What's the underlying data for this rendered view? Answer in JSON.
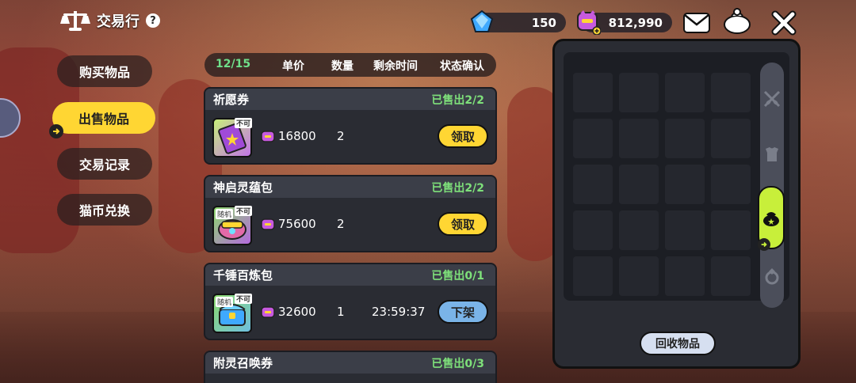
{
  "title": {
    "text": "交易行",
    "help_icon": "question-circle-icon"
  },
  "currency": {
    "diamond": {
      "icon": "diamond-gem-icon",
      "value": "150"
    },
    "cat_coin": {
      "icon": "cat-coin-add-icon",
      "value": "812,990"
    }
  },
  "top_buttons": [
    {
      "name": "mail",
      "icon": "envelope-icon"
    },
    {
      "name": "bag",
      "icon": "money-bag-icon"
    },
    {
      "name": "close",
      "icon": "close-x-icon"
    }
  ],
  "nav": {
    "items": [
      {
        "label": "购买物品",
        "active": false
      },
      {
        "label": "出售物品",
        "active": true
      },
      {
        "label": "交易记录",
        "active": false
      },
      {
        "label": "猫币兑换",
        "active": false
      }
    ]
  },
  "columns": {
    "count": "12/15",
    "unit_price": "单价",
    "quantity": "数量",
    "remaining_time": "剩余时间",
    "status_confirm": "状态确认"
  },
  "sales": [
    {
      "name": "祈愿券",
      "status": "已售出2/2",
      "price": "16800",
      "qty": "2",
      "time": "",
      "button": "领取",
      "button_style": "yellow",
      "icon": "wish-ticket-icon",
      "tag": "",
      "stamp": "不可"
    },
    {
      "name": "神启灵蕴包",
      "status": "已售出2/2",
      "price": "75600",
      "qty": "2",
      "time": "",
      "button": "领取",
      "button_style": "yellow",
      "icon": "treasure-pack-icon",
      "tag": "随机",
      "stamp": "不可"
    },
    {
      "name": "千锤百炼包",
      "status": "已售出0/1",
      "price": "32600",
      "qty": "1",
      "time": "23:59:37",
      "button": "下架",
      "button_style": "blue",
      "icon": "treasure-pack-icon",
      "tag": "随机",
      "stamp": "不可"
    },
    {
      "name": "附灵召唤券",
      "status": "已售出0/3"
    }
  ],
  "inventory": {
    "tabs": [
      {
        "icon": "crossed-swords-icon",
        "active": false
      },
      {
        "icon": "armor-icon",
        "active": false
      },
      {
        "icon": "loot-bag-icon",
        "active": true
      },
      {
        "icon": "gem-ring-icon",
        "active": false
      }
    ],
    "recycle_label": "回收物品"
  },
  "colors": {
    "accent_yellow": "#ffd633",
    "status_green": "#7ee07a",
    "count_green": "#6fe08a",
    "tab_active": "#c8ef3a",
    "button_blue": "#7ab4e8",
    "panel_dark": "#2a2c33"
  }
}
